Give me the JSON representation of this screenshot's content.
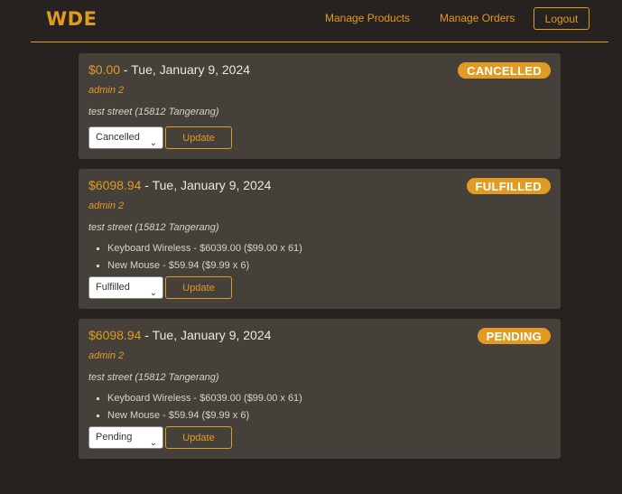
{
  "nav": {
    "brand": "WDE",
    "manage_products": "Manage Products",
    "manage_orders": "Manage Orders",
    "logout": "Logout"
  },
  "colors": {
    "accent": "#e39a23",
    "background": "#262220",
    "card": "#454039"
  },
  "orders": [
    {
      "total": "$0.00",
      "separator": " - ",
      "date": "Tue, January 9, 2024",
      "status": "CANCELLED",
      "customer": "admin 2",
      "address": "test street (15812 Tangerang)",
      "items": [],
      "selected_status": "Cancelled",
      "update_label": "Update"
    },
    {
      "total": "$6098.94",
      "separator": " - ",
      "date": "Tue, January 9, 2024",
      "status": "FULFILLED",
      "customer": "admin 2",
      "address": "test street (15812 Tangerang)",
      "items": [
        "Keyboard Wireless - $6039.00 ($99.00 x 61)",
        "New Mouse - $59.94 ($9.99 x 6)"
      ],
      "selected_status": "Fulfilled",
      "update_label": "Update"
    },
    {
      "total": "$6098.94",
      "separator": " - ",
      "date": "Tue, January 9, 2024",
      "status": "PENDING",
      "customer": "admin 2",
      "address": "test street (15812 Tangerang)",
      "items": [
        "Keyboard Wireless - $6039.00 ($99.00 x 61)",
        "New Mouse - $59.94 ($9.99 x 6)"
      ],
      "selected_status": "Pending",
      "update_label": "Update"
    }
  ],
  "icons": {
    "select_arrow": "chevron-down-icon"
  }
}
